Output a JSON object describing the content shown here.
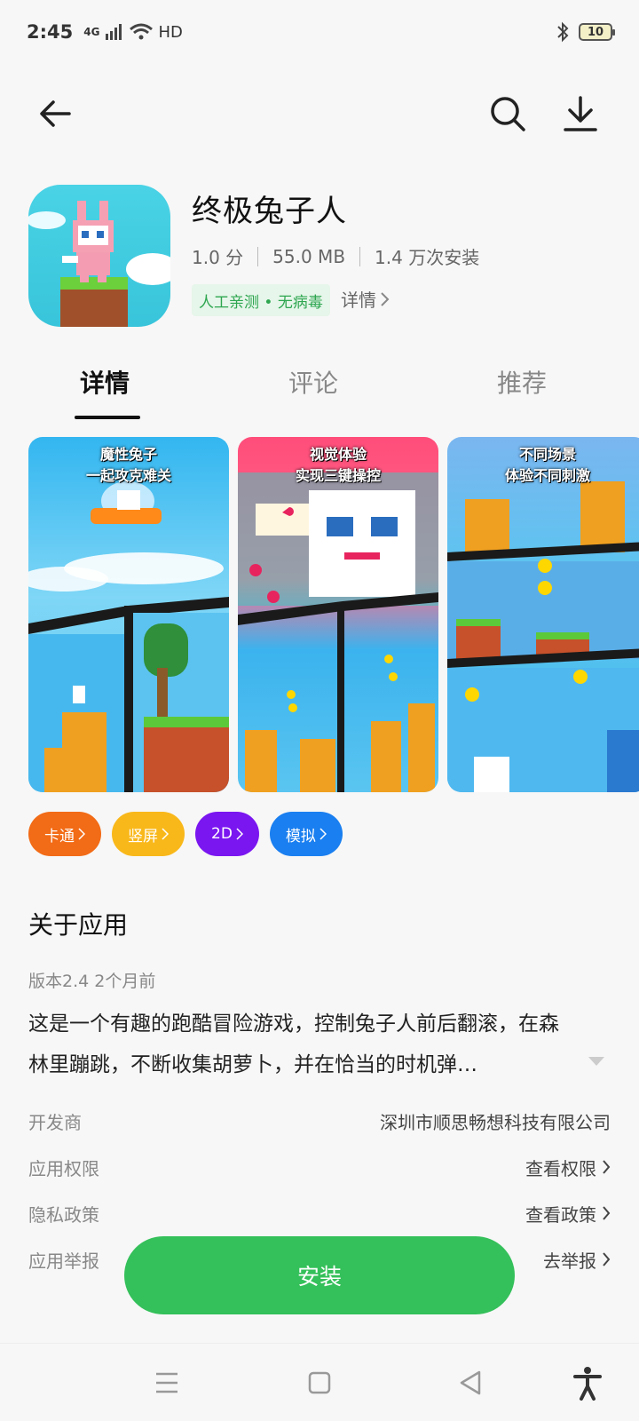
{
  "status": {
    "time": "2:45",
    "network": "4G",
    "hd": "HD",
    "battery": "10"
  },
  "topbar": {
    "back": "back-arrow-icon",
    "search": "search-icon",
    "download": "download-icon"
  },
  "app": {
    "name": "终极兔子人",
    "rating": "1.0 分",
    "size": "55.0 MB",
    "installs": "1.4 万次安装",
    "badge": "人工亲测 • 无病毒",
    "details_link": "详情"
  },
  "tabs": [
    {
      "label": "详情"
    },
    {
      "label": "评论"
    },
    {
      "label": "推荐"
    }
  ],
  "screenshots": [
    {
      "caption1": "魔性兔子",
      "caption2": "一起攻克难关"
    },
    {
      "caption1": "视觉体验",
      "caption2": "实现三键操控"
    },
    {
      "caption1": "不同场景",
      "caption2": "体验不同刺激"
    }
  ],
  "tags": [
    {
      "label": "卡通",
      "color": "#f26b16"
    },
    {
      "label": "竖屏",
      "color": "#f9b81a"
    },
    {
      "label": "2D",
      "color": "#7a16f0"
    },
    {
      "label": "模拟",
      "color": "#1a7ff0"
    }
  ],
  "about": {
    "title": "关于应用",
    "version": "版本2.4  2个月前",
    "description": "这是一个有趣的跑酷冒险游戏，控制兔子人前后翻滚，在森林里蹦跳，不断收集胡萝卜，并在恰当的时机弹…"
  },
  "info_rows": [
    {
      "label": "开发商",
      "value": "深圳市顺思畅想科技有限公司"
    },
    {
      "label": "应用权限",
      "value": "查看权限"
    },
    {
      "label": "隐私政策",
      "value": "查看政策"
    },
    {
      "label": "应用举报",
      "value": "去举报"
    }
  ],
  "install_button": "安装",
  "colors": {
    "accent_green": "#34c05a",
    "badge_green": "#2ea650"
  }
}
